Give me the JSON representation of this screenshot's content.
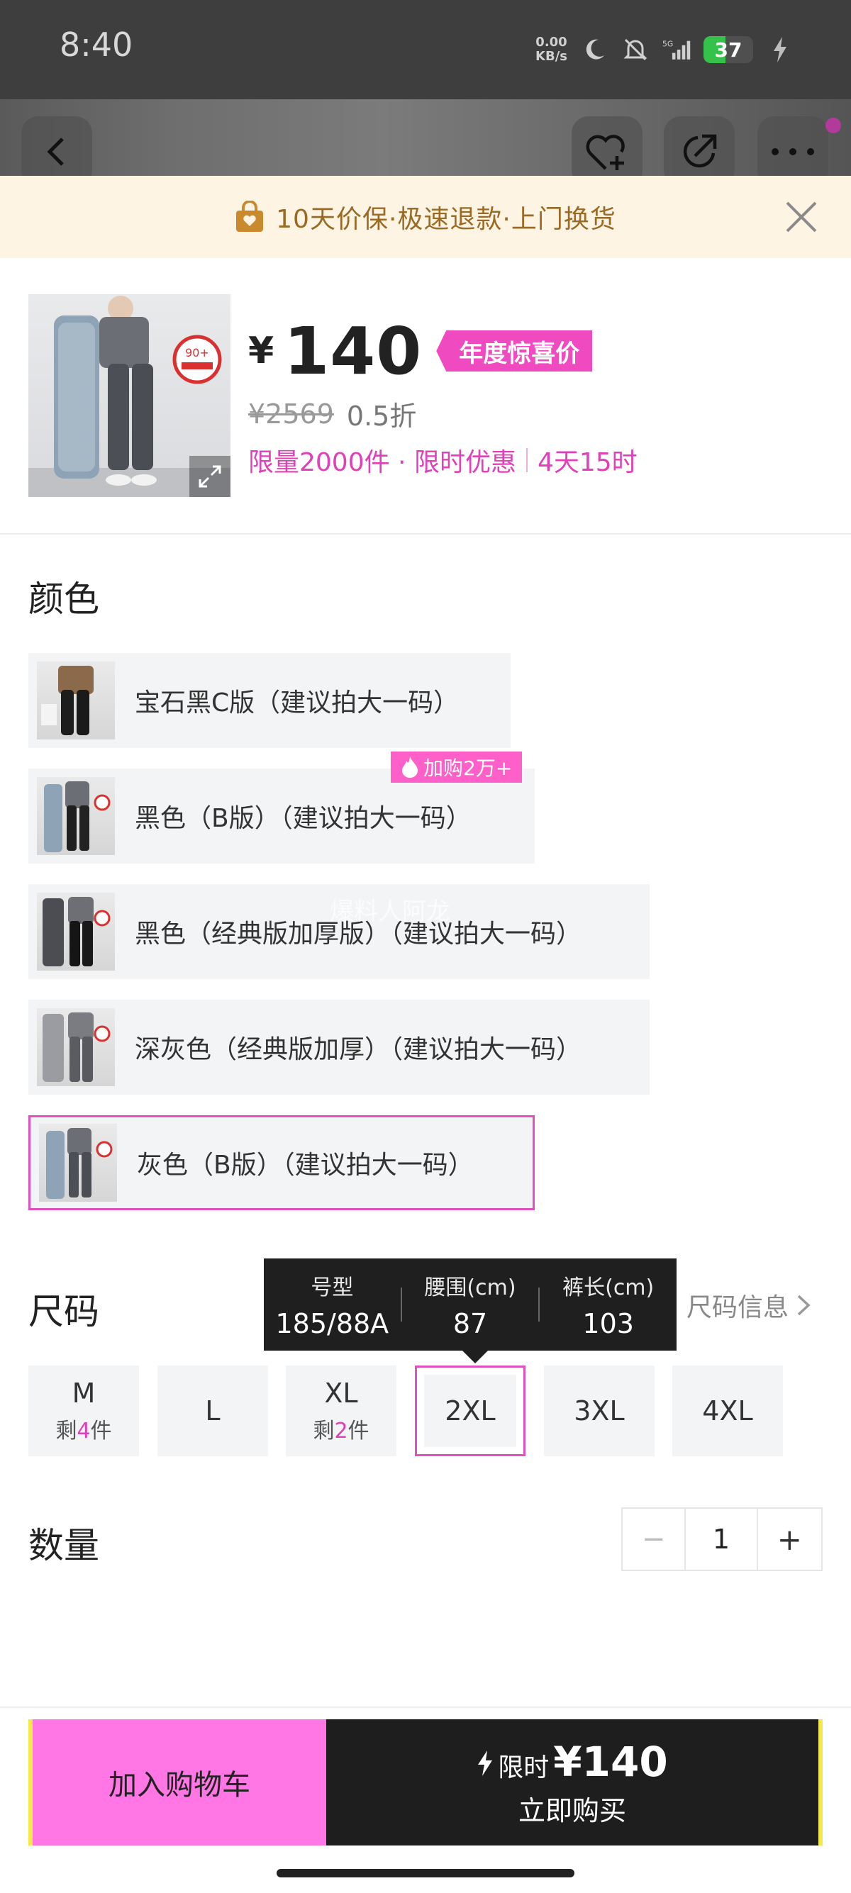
{
  "status_bar": {
    "time": "8:40",
    "net_speed_value": "0.00",
    "net_speed_unit": "KB/s",
    "network": "5G",
    "battery": "37"
  },
  "banner": {
    "text": "10天价保·极速退款·上门换货"
  },
  "product": {
    "currency": "¥",
    "price": "140",
    "tag": "年度惊喜价",
    "original_price": "¥2569",
    "discount": "0.5折",
    "promo_limit": "限量2000件 · 限时优惠",
    "promo_time": "4天15时",
    "thumb_badge": "90+"
  },
  "color_section": {
    "title": "颜色",
    "hot_badge": "加购2万+",
    "options": [
      {
        "label": "宝石黑C版（建议拍大一码）"
      },
      {
        "label": "黑色（B版）（建议拍大一码）"
      },
      {
        "label": "黑色（经典版加厚版）（建议拍大一码）"
      },
      {
        "label": "深灰色（经典版加厚）（建议拍大一码）"
      },
      {
        "label": "灰色（B版）（建议拍大一码）"
      }
    ],
    "selected_index": 4
  },
  "watermark": "爆料人阿龙",
  "size_section": {
    "title": "尺码",
    "info_link": "尺码信息",
    "tooltip": [
      {
        "header": "号型",
        "value": "185/88A"
      },
      {
        "header": "腰围(cm)",
        "value": "87"
      },
      {
        "header": "裤长(cm)",
        "value": "103"
      }
    ],
    "options": [
      {
        "size": "M",
        "stock_pre": "剩",
        "stock_num": "4",
        "stock_post": "件"
      },
      {
        "size": "L"
      },
      {
        "size": "XL",
        "stock_pre": "剩",
        "stock_num": "2",
        "stock_post": "件"
      },
      {
        "size": "2XL"
      },
      {
        "size": "3XL"
      },
      {
        "size": "4XL"
      }
    ],
    "selected": "2XL"
  },
  "quantity": {
    "title": "数量",
    "value": "1",
    "minus": "−",
    "plus": "+"
  },
  "bottom_bar": {
    "cart_label": "加入购物车",
    "buy_flash": "限时",
    "buy_price": "¥140",
    "buy_label": "立即购买"
  },
  "colors": {
    "accent_pink": "#e040b8",
    "tag_pink": "#f04ac0",
    "cart_pink": "#ff76e4",
    "buy_dark": "#1e1e1e",
    "banner_bg": "#fdf4e4",
    "banner_text": "#9b6a24"
  }
}
